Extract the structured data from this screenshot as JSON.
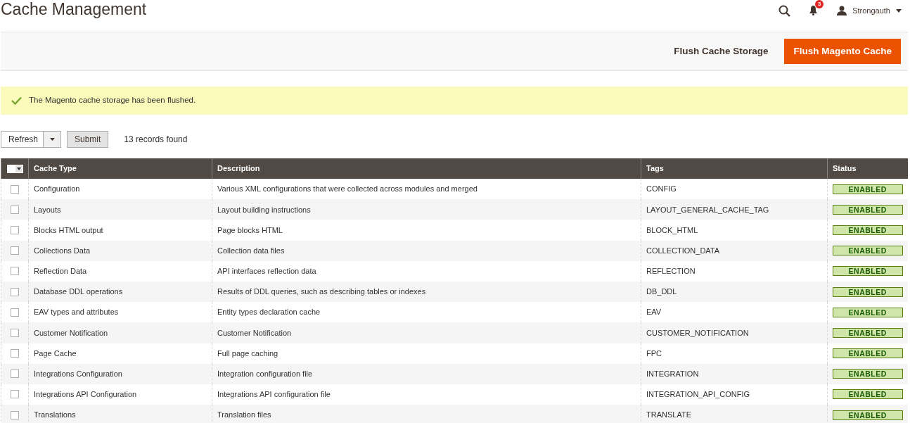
{
  "page_title": "Cache Management",
  "header": {
    "notification_count": "3",
    "user": "Strongauth"
  },
  "actions": [
    {
      "label": "Flush Cache Storage",
      "kind": "secondary"
    },
    {
      "label": "Flush Magento Cache",
      "kind": "primary"
    }
  ],
  "message": "The Magento cache storage has been flushed.",
  "mass_action": {
    "value": "Refresh",
    "submit": "Submit",
    "records": "13 records found"
  },
  "table": {
    "mass_select_checked": false,
    "columns": [
      "Cache Type",
      "Description",
      "Tags",
      "Status"
    ],
    "rows": [
      {
        "checked": false,
        "cache_type": "Configuration",
        "description": "Various XML configurations that were collected across modules and merged",
        "tags": "CONFIG",
        "status": "ENABLED",
        "enabled": true
      },
      {
        "checked": false,
        "cache_type": "Layouts",
        "description": "Layout building instructions",
        "tags": "LAYOUT_GENERAL_CACHE_TAG",
        "status": "ENABLED",
        "enabled": true
      },
      {
        "checked": false,
        "cache_type": "Blocks HTML output",
        "description": "Page blocks HTML",
        "tags": "BLOCK_HTML",
        "status": "ENABLED",
        "enabled": true
      },
      {
        "checked": false,
        "cache_type": "Collections Data",
        "description": "Collection data files",
        "tags": "COLLECTION_DATA",
        "status": "ENABLED",
        "enabled": true
      },
      {
        "checked": false,
        "cache_type": "Reflection Data",
        "description": "API interfaces reflection data",
        "tags": "REFLECTION",
        "status": "ENABLED",
        "enabled": true
      },
      {
        "checked": false,
        "cache_type": "Database DDL operations",
        "description": "Results of DDL queries, such as describing tables or indexes",
        "tags": "DB_DDL",
        "status": "ENABLED",
        "enabled": true
      },
      {
        "checked": false,
        "cache_type": "EAV types and attributes",
        "description": "Entity types declaration cache",
        "tags": "EAV",
        "status": "ENABLED",
        "enabled": true
      },
      {
        "checked": false,
        "cache_type": "Customer Notification",
        "description": "Customer Notification",
        "tags": "CUSTOMER_NOTIFICATION",
        "status": "ENABLED",
        "enabled": true
      },
      {
        "checked": false,
        "cache_type": "Page Cache",
        "description": "Full page caching",
        "tags": "FPC",
        "status": "ENABLED",
        "enabled": true
      },
      {
        "checked": false,
        "cache_type": "Integrations Configuration",
        "description": "Integration configuration file",
        "tags": "INTEGRATION",
        "status": "ENABLED",
        "enabled": true
      },
      {
        "checked": false,
        "cache_type": "Integrations API Configuration",
        "description": "Integrations API configuration file",
        "tags": "INTEGRATION_API_CONFIG",
        "status": "ENABLED",
        "enabled": true
      },
      {
        "checked": false,
        "cache_type": "Translations",
        "description": "Translation files",
        "tags": "TRANSLATE",
        "status": "ENABLED",
        "enabled": true
      }
    ]
  }
}
